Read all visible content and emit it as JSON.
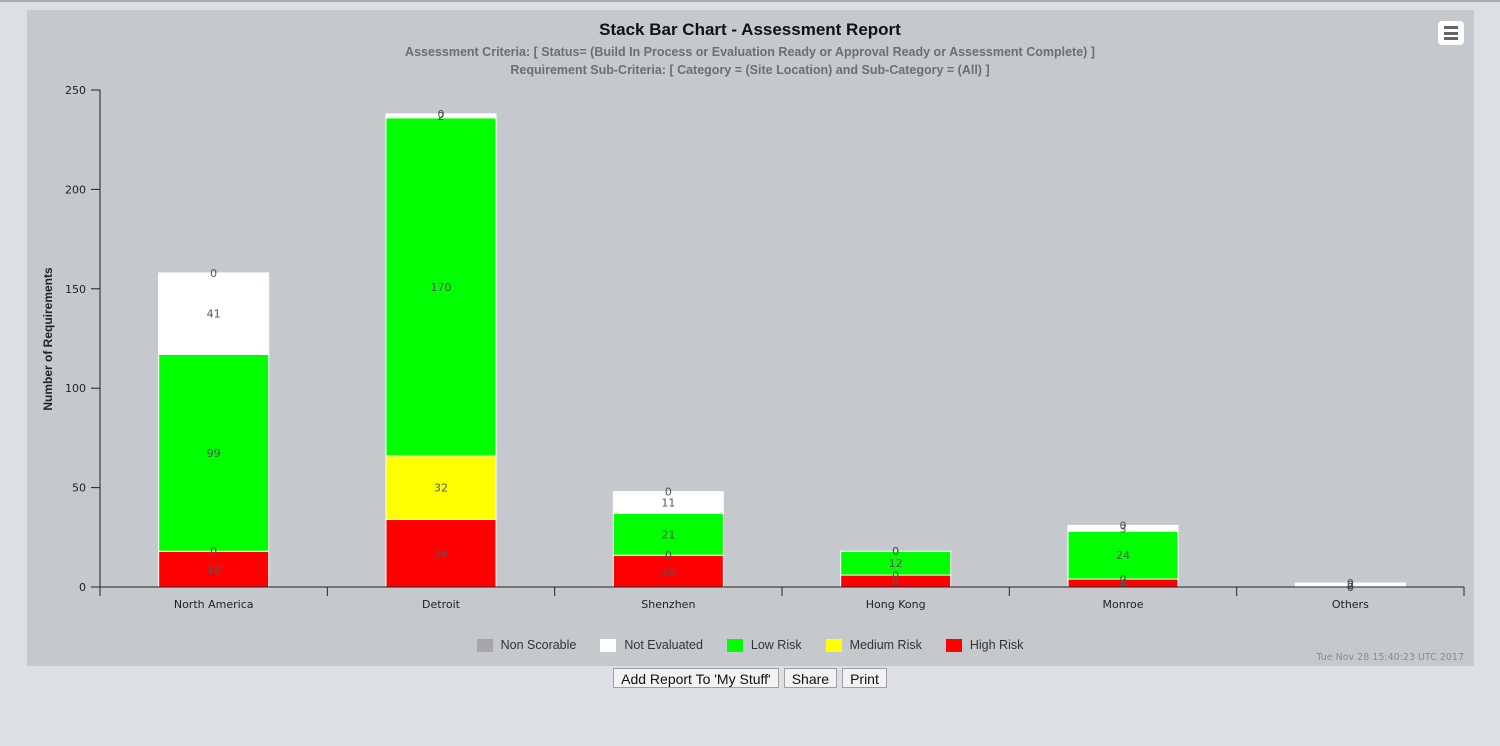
{
  "chart_data": {
    "type": "bar",
    "stacked": true,
    "title": "Stack Bar Chart - Assessment Report",
    "subtitle": [
      "Assessment Criteria: [ Status= (Build In Process or Evaluation Ready or Approval Ready or Assessment Complete) ]",
      "Requirement Sub-Criteria: [ Category = (Site Location) and Sub-Category = (All) ]"
    ],
    "xlabel": "",
    "ylabel": "Number of Requirements",
    "ylim": [
      0,
      250
    ],
    "yticks": [
      0,
      50,
      100,
      150,
      200,
      250
    ],
    "grid": false,
    "legend_position": "bottom",
    "categories": [
      "North America",
      "Detroit",
      "Shenzhen",
      "Hong Kong",
      "Monroe",
      "Others"
    ],
    "series": [
      {
        "name": "High Risk",
        "color": "#ff0000",
        "values": [
          18,
          34,
          16,
          6,
          4,
          0
        ]
      },
      {
        "name": "Medium Risk",
        "color": "#ffff00",
        "values": [
          0,
          32,
          0,
          0,
          0,
          0
        ]
      },
      {
        "name": "Low Risk",
        "color": "#00ff00",
        "values": [
          99,
          170,
          21,
          12,
          24,
          0
        ]
      },
      {
        "name": "Not Evaluated",
        "color": "#ffffff",
        "values": [
          41,
          2,
          11,
          0,
          3,
          2
        ]
      },
      {
        "name": "Non Scorable",
        "color": "#a6a6a6",
        "values": [
          0,
          0,
          0,
          0,
          0,
          0
        ]
      }
    ],
    "legend_order": [
      "Non Scorable",
      "Not Evaluated",
      "Low Risk",
      "Medium Risk",
      "High Risk"
    ]
  },
  "timestamp": "Tue Nov 28 15:40:23 UTC 2017",
  "menu_icon": "hamburger-menu-icon",
  "buttons": {
    "add_report": "Add Report To 'My Stuff'",
    "share": "Share",
    "print": "Print"
  }
}
